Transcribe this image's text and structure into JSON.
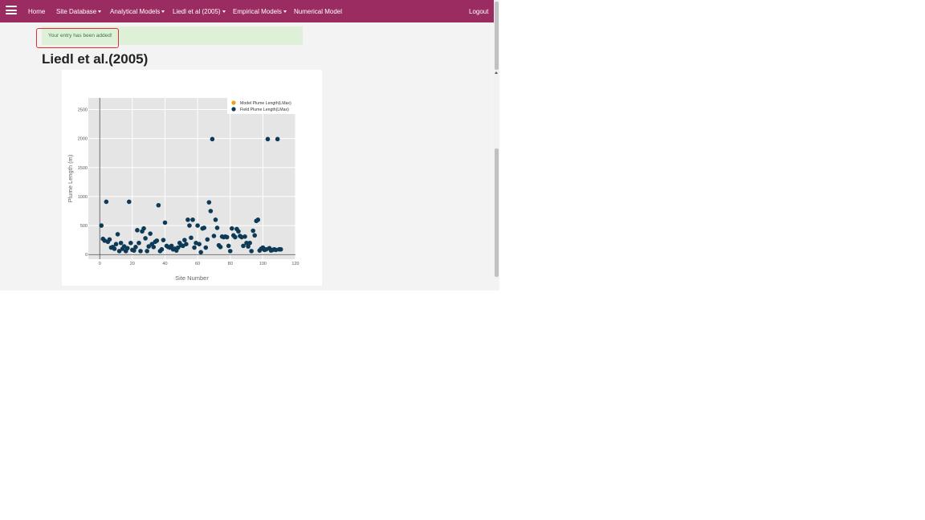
{
  "navbar": {
    "items": [
      {
        "label": "Home",
        "dropdown": false
      },
      {
        "label": "Site Database",
        "dropdown": true
      },
      {
        "label": "Analytical Models",
        "dropdown": true
      },
      {
        "label": "Liedl et al (2005)",
        "dropdown": true
      },
      {
        "label": "Empirical Models",
        "dropdown": true
      },
      {
        "label": "Numerical Model",
        "dropdown": false
      }
    ],
    "logout_label": "Logout",
    "background": "#9b2c62"
  },
  "alert": {
    "message": "Your entry has been added!"
  },
  "page": {
    "title": "Liedl et al.(2005)"
  },
  "chart_data": {
    "type": "scatter",
    "xlabel": "Site Number",
    "ylabel": "Plume Length (m)",
    "xlim": [
      -7,
      120
    ],
    "ylim": [
      -80,
      2700
    ],
    "x_ticks": [
      0,
      20,
      40,
      60,
      80,
      100,
      120
    ],
    "y_ticks": [
      0,
      500,
      1000,
      1500,
      2000,
      2500
    ],
    "grid": true,
    "legend_position": "top-right",
    "series": [
      {
        "name": "Model Plume Length(LMax)",
        "color": "#f0a30a",
        "x": [],
        "y": []
      },
      {
        "name": "Field Plume Length(LMax)",
        "color": "#0d3b57",
        "x": [
          1,
          2,
          3,
          4,
          5,
          6,
          7,
          8,
          9,
          10,
          11,
          12,
          13,
          14,
          15,
          16,
          17,
          18,
          19,
          20,
          21,
          22,
          23,
          24,
          25,
          26,
          27,
          28,
          29,
          30,
          31,
          32,
          33,
          34,
          35,
          36,
          37,
          38,
          39,
          40,
          41,
          42,
          43,
          44,
          45,
          46,
          47,
          48,
          49,
          50,
          51,
          52,
          53,
          54,
          55,
          56,
          57,
          58,
          59,
          60,
          61,
          62,
          63,
          64,
          65,
          66,
          67,
          68,
          69,
          70,
          71,
          72,
          73,
          74,
          75,
          76,
          77,
          78,
          79,
          80,
          81,
          82,
          83,
          84,
          85,
          86,
          87,
          88,
          89,
          90,
          91,
          92,
          93,
          94,
          95,
          96,
          97,
          98,
          99,
          100,
          101,
          102,
          103,
          104,
          105,
          106,
          107,
          108,
          109,
          110,
          111
        ],
        "y": [
          500,
          270,
          240,
          910,
          220,
          260,
          120,
          130,
          100,
          180,
          350,
          60,
          200,
          100,
          140,
          60,
          110,
          910,
          200,
          80,
          70,
          130,
          420,
          200,
          60,
          400,
          450,
          280,
          60,
          140,
          360,
          180,
          130,
          220,
          240,
          850,
          60,
          90,
          250,
          550,
          150,
          130,
          120,
          150,
          90,
          100,
          70,
          120,
          200,
          160,
          150,
          250,
          180,
          600,
          500,
          290,
          600,
          120,
          200,
          500,
          180,
          40,
          450,
          460,
          120,
          260,
          900,
          750,
          1990,
          320,
          600,
          460,
          160,
          130,
          310,
          300,
          310,
          300,
          150,
          60,
          450,
          330,
          300,
          440,
          400,
          320,
          300,
          150,
          310,
          200,
          140,
          200,
          60,
          410,
          330,
          580,
          600,
          70,
          100,
          120,
          80,
          90,
          1990,
          110,
          70,
          80,
          90,
          80,
          1990,
          90,
          90
        ]
      }
    ]
  }
}
